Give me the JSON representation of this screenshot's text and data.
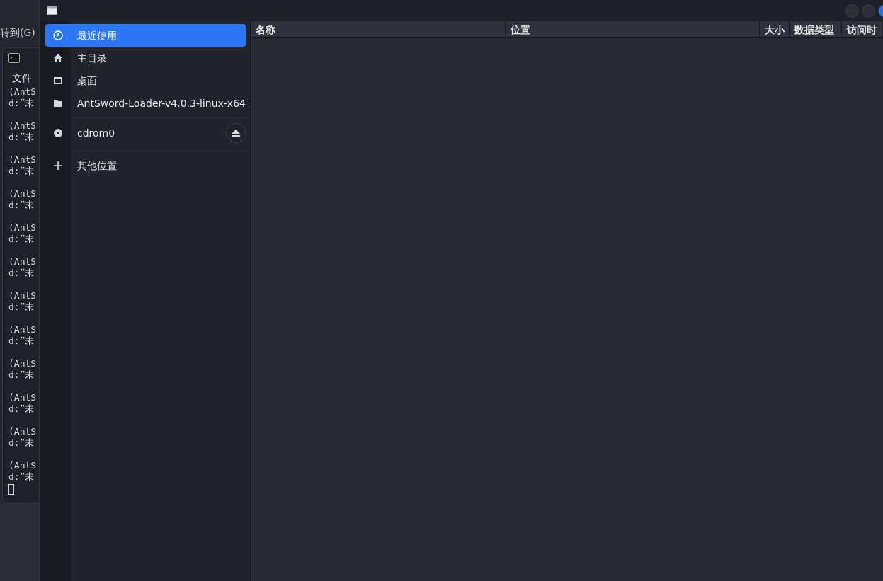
{
  "background_window": {
    "menu_item": "转到(G)",
    "terminal": {
      "menu": "文件",
      "entries": [
        {
          "lines": [
            "(AntS",
            "d:”未"
          ]
        },
        {
          "lines": [
            "(AntS",
            "d:”未"
          ]
        },
        {
          "lines": [
            "(AntS",
            "d:”未"
          ]
        },
        {
          "lines": [
            "(AntS",
            "d:”未"
          ]
        },
        {
          "lines": [
            "(AntS",
            "d:”未"
          ]
        },
        {
          "lines": [
            "(AntS",
            "d:”未"
          ]
        },
        {
          "lines": [
            "(AntS",
            "d:”未"
          ]
        },
        {
          "lines": [
            "(AntS",
            "d:”未"
          ]
        },
        {
          "lines": [
            "(AntS",
            "d:”未"
          ]
        },
        {
          "lines": [
            "(AntS",
            "d:”未"
          ]
        },
        {
          "lines": [
            "(AntS",
            "d:”未"
          ]
        },
        {
          "lines": [
            "(AntS",
            "d:”未"
          ]
        }
      ]
    }
  },
  "dialog": {
    "sidebar": {
      "items": [
        {
          "kind": "recent",
          "label": "最近使用",
          "selected": true
        },
        {
          "kind": "home",
          "label": "主目录",
          "selected": false
        },
        {
          "kind": "desktop",
          "label": "桌面",
          "selected": false
        },
        {
          "kind": "folder",
          "label": "AntSword-Loader-v4.0.3-linux-x64",
          "selected": false
        },
        {
          "kind": "drive",
          "label": "cdrom0",
          "selected": false
        },
        {
          "kind": "other",
          "label": "其他位置",
          "selected": false
        }
      ]
    },
    "columns": [
      "名称",
      "位置",
      "大小",
      "数据类型",
      "访问时"
    ]
  }
}
